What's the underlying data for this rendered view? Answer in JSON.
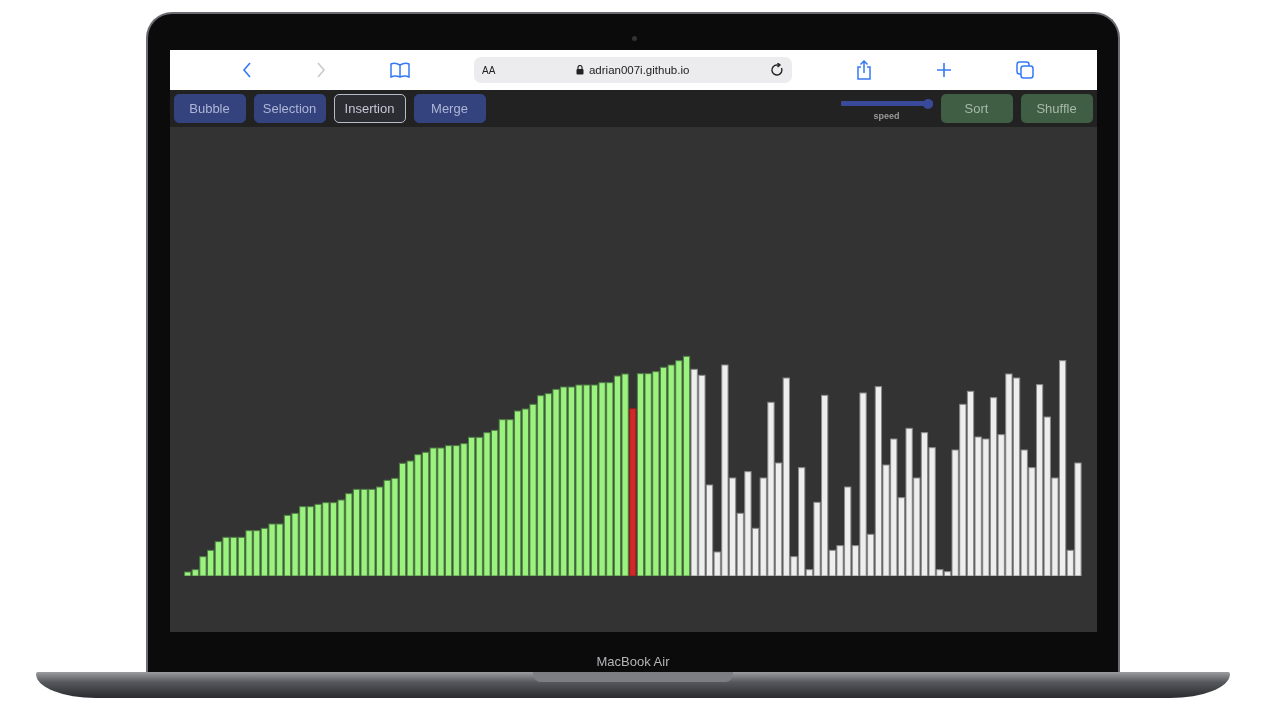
{
  "browser": {
    "text_size_button": "AA",
    "url": "adrian007i.github.io"
  },
  "algorithms": [
    {
      "label": "Bubble",
      "selected": false
    },
    {
      "label": "Selection",
      "selected": false
    },
    {
      "label": "Insertion",
      "selected": true
    },
    {
      "label": "Merge",
      "selected": false
    }
  ],
  "speed": {
    "label": "speed",
    "level": 1
  },
  "actions": [
    {
      "label": "Sort"
    },
    {
      "label": "Shuffle"
    }
  ],
  "device_label": "MacBook Air"
}
